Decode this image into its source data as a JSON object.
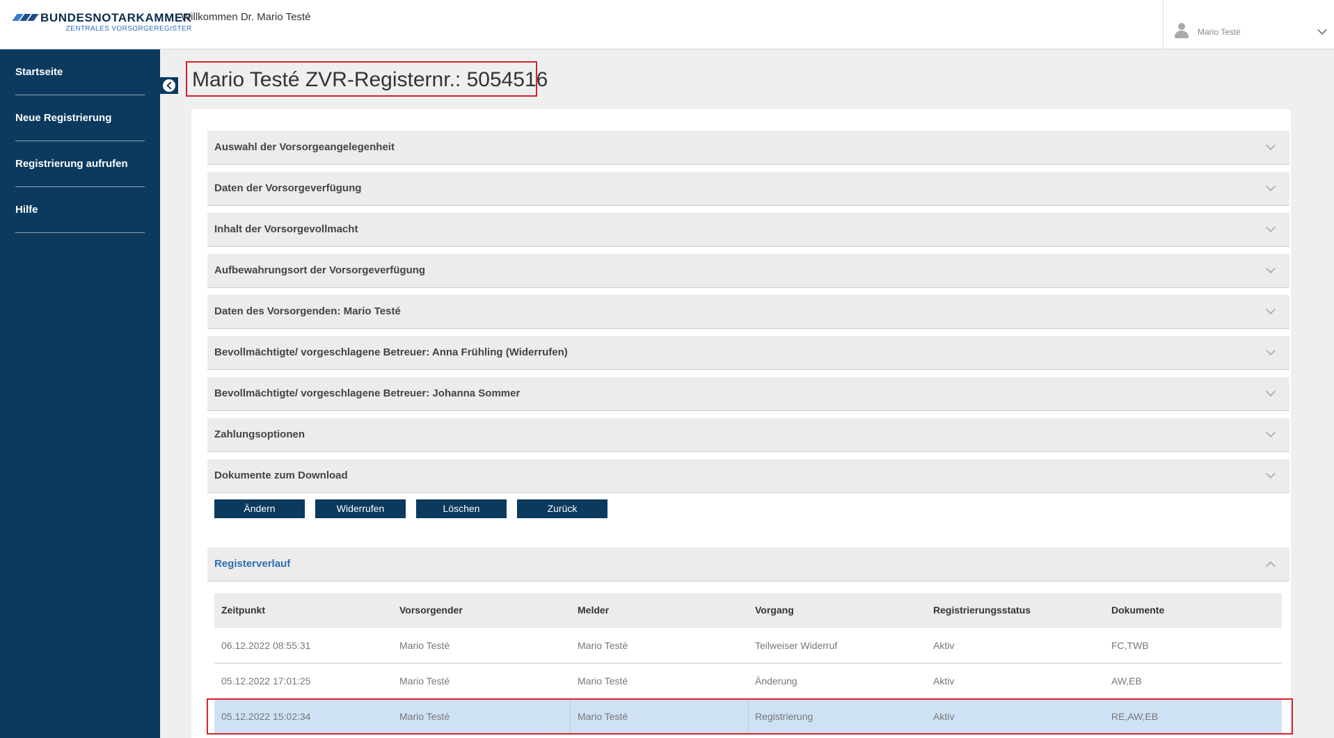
{
  "header": {
    "logo_title": "BUNDESNOTARKAMMER",
    "logo_subtitle": "ZENTRALES VORSORGEREGISTER",
    "welcome": "Willkommen Dr. Mario Testé",
    "user_name": "Mario Testé"
  },
  "sidebar": {
    "items": [
      {
        "label": "Startseite"
      },
      {
        "label": "Neue Registrierung"
      },
      {
        "label": "Registrierung aufrufen"
      },
      {
        "label": "Hilfe"
      }
    ]
  },
  "page_title": "Mario Testé ZVR-Registernr.: 5054516",
  "sections": [
    {
      "label": "Auswahl der Vorsorgeangelegenheit"
    },
    {
      "label": "Daten der Vorsorgeverfügung"
    },
    {
      "label": "Inhalt der Vorsorgevollmacht"
    },
    {
      "label": "Aufbewahrungsort der Vorsorgeverfügung"
    },
    {
      "label": "Daten des Vorsorgenden: Mario Testé"
    },
    {
      "label": "Bevollmächtigte/ vorgeschlagene Betreuer: Anna Frühling (Widerrufen)"
    },
    {
      "label": "Bevollmächtigte/ vorgeschlagene Betreuer: Johanna Sommer"
    },
    {
      "label": "Zahlungsoptionen"
    },
    {
      "label": "Dokumente zum Download"
    }
  ],
  "actions": {
    "change": "Ändern",
    "revoke": "Widerrufen",
    "delete": "Löschen",
    "back": "Zurück"
  },
  "history": {
    "title": "Registerverlauf",
    "columns": [
      "Zeitpunkt",
      "Vorsorgender",
      "Melder",
      "Vorgang",
      "Registrierungsstatus",
      "Dokumente"
    ],
    "rows": [
      [
        "06.12.2022 08:55:31",
        "Mario Testé",
        "Mario Testé",
        "Teilweiser Widerruf",
        "Aktiv",
        "FC,TWB"
      ],
      [
        "05.12.2022 17:01:25",
        "Mario Testé",
        "Mario Testé",
        "Änderung",
        "Aktiv",
        "AW,EB"
      ],
      [
        "05.12.2022 15:02:34",
        "Mario Testé",
        "Mario Testé",
        "Registrierung",
        "Aktiv",
        "RE,AW,EB"
      ]
    ],
    "selected_row": 2
  },
  "colors": {
    "sidebar_bg": "#0b3a5e",
    "accent_blue": "#2c6fb3",
    "highlight_red": "#d9202a",
    "selected_row_bg": "#cfe2f5"
  }
}
